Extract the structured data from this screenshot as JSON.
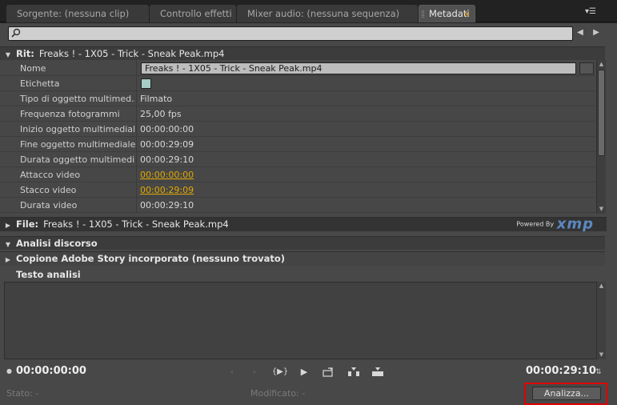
{
  "tabs": [
    {
      "label": "Sorgente: (nessuna clip)"
    },
    {
      "label": "Controllo effetti"
    },
    {
      "label": "Mixer audio: (nessuna sequenza)"
    },
    {
      "label": "Metadati",
      "close": "×"
    }
  ],
  "panel_menu": "▾☰",
  "search": {
    "placeholder": "",
    "value": ""
  },
  "clip_section": {
    "title": "Rit:",
    "subtitle": "Freaks ! - 1X05 - Trick - Sneak Peak.mp4"
  },
  "properties": [
    {
      "label": "Nome",
      "value": "Freaks ! - 1X05 - Trick - Sneak Peak.mp4"
    },
    {
      "label": "Etichetta",
      "value": ""
    },
    {
      "label": "Tipo di oggetto multimed...",
      "value": "Filmato"
    },
    {
      "label": "Frequenza fotogrammi",
      "value": "25,00 fps"
    },
    {
      "label": "Inizio oggetto multimediale",
      "value": "00:00:00:00"
    },
    {
      "label": "Fine oggetto multimediale",
      "value": "00:00:29:09"
    },
    {
      "label": "Durata oggetto multimedi...",
      "value": "00:00:29:10"
    },
    {
      "label": "Attacco video",
      "value": "00:00:00:00"
    },
    {
      "label": "Stacco video",
      "value": "00:00:29:09"
    },
    {
      "label": "Durata video",
      "value": "00:00:29:10"
    }
  ],
  "file_section": {
    "title": "File:",
    "subtitle": "Freaks ! - 1X05 - Trick - Sneak Peak.mp4"
  },
  "xmp_logo": {
    "powered_by": "Powered By",
    "mark": "xmp"
  },
  "speech_section": {
    "title": "Analisi discorso"
  },
  "story_section": {
    "title": "Copione Adobe Story incorporato (nessuno trovato)"
  },
  "analysis_text_section": {
    "title": "Testo analisi"
  },
  "transport": {
    "timecode_in": "00:00:00:00",
    "timecode_out": "00:00:29:10"
  },
  "status": {
    "stato": "Stato: -",
    "modificato": "Modificato: -"
  },
  "analyze_button": "Analizza...",
  "colors": {
    "label_swatch": "#a6ccc6",
    "link": "#e0a800",
    "highlight": "#e00000",
    "xmp": "#5b88c0"
  }
}
